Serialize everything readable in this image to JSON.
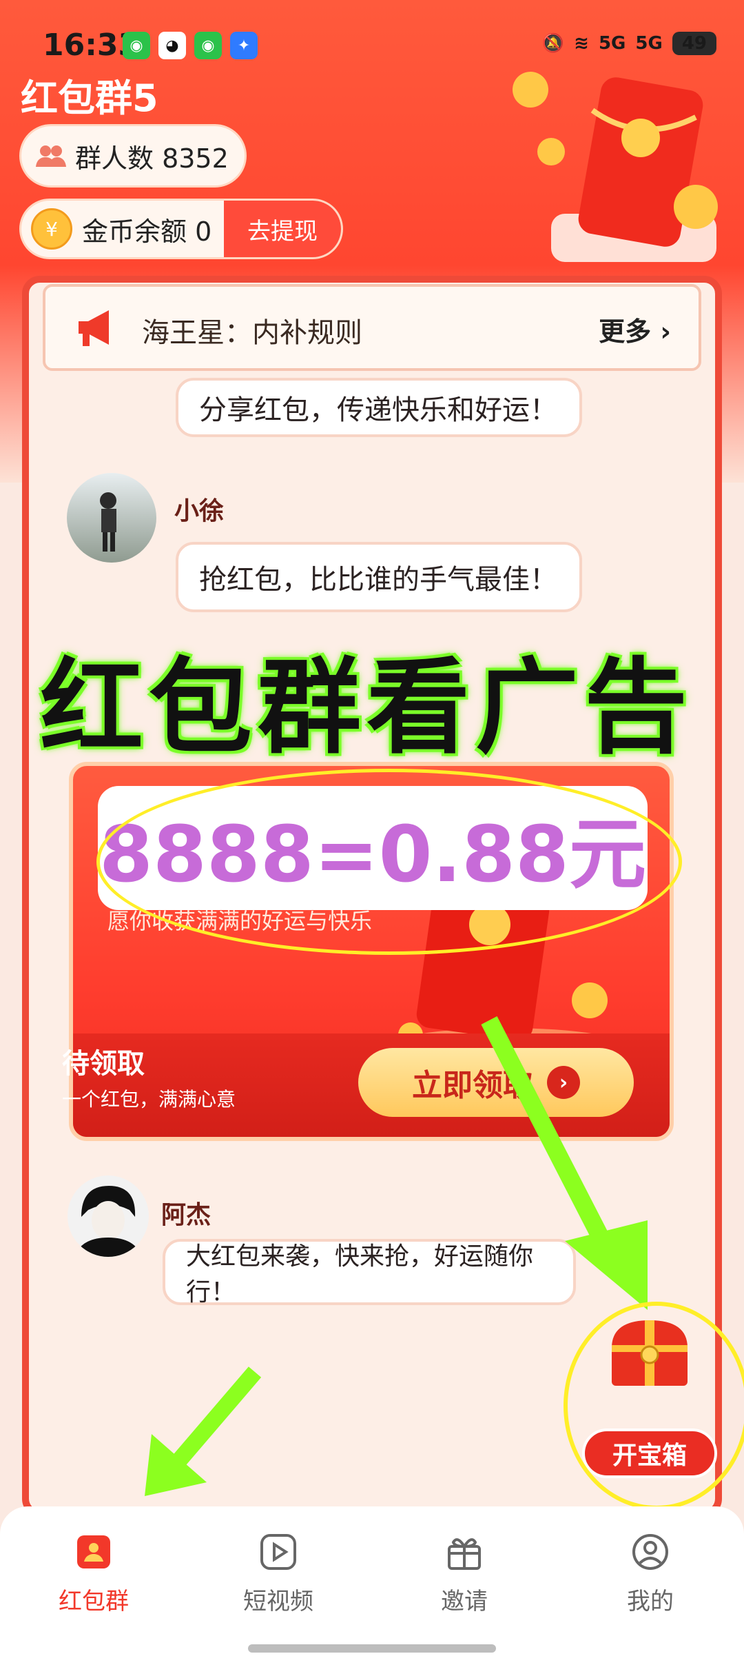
{
  "status_bar": {
    "time": "16:33",
    "signal_5g_1": "5G",
    "signal_5g_2": "5G",
    "battery": "49"
  },
  "header": {
    "title": "红包群5",
    "members_label": "群人数 8352",
    "coin_label": "金币余额 0",
    "coin_symbol": "¥",
    "withdraw_button": "去提现"
  },
  "notice": {
    "text": "海王星：内补规则",
    "more": "更多 ›"
  },
  "messages": [
    {
      "name": "",
      "text": "分享红包，传递快乐和好运！"
    },
    {
      "name": "小徐",
      "text": "抢红包，比比谁的手气最佳！"
    },
    {
      "name": "阿杰",
      "text": "大红包来袭，快来抢，好运随你行！"
    }
  ],
  "overlay": {
    "headline": "红包群看广告",
    "price": "8888=0.88元"
  },
  "red_packet_card": {
    "subtitle": "愿你收获满满的好运与快乐",
    "status": "待领取",
    "status_sub": "一个红包，满满心意",
    "claim_button": "立即领取",
    "claim_arrow": "›"
  },
  "treasure": {
    "button": "开宝箱"
  },
  "tabbar": {
    "items": [
      {
        "label": "红包群",
        "icon": "red-packet-group-icon",
        "active": true
      },
      {
        "label": "短视频",
        "icon": "play-icon",
        "active": false
      },
      {
        "label": "邀请",
        "icon": "gift-icon",
        "active": false
      },
      {
        "label": "我的",
        "icon": "profile-icon",
        "active": false
      }
    ]
  },
  "colors": {
    "primary_red": "#ff4630",
    "tab_active": "#f2382a",
    "highlight_green": "#7cff2a",
    "highlight_yellow": "#ffee28"
  }
}
